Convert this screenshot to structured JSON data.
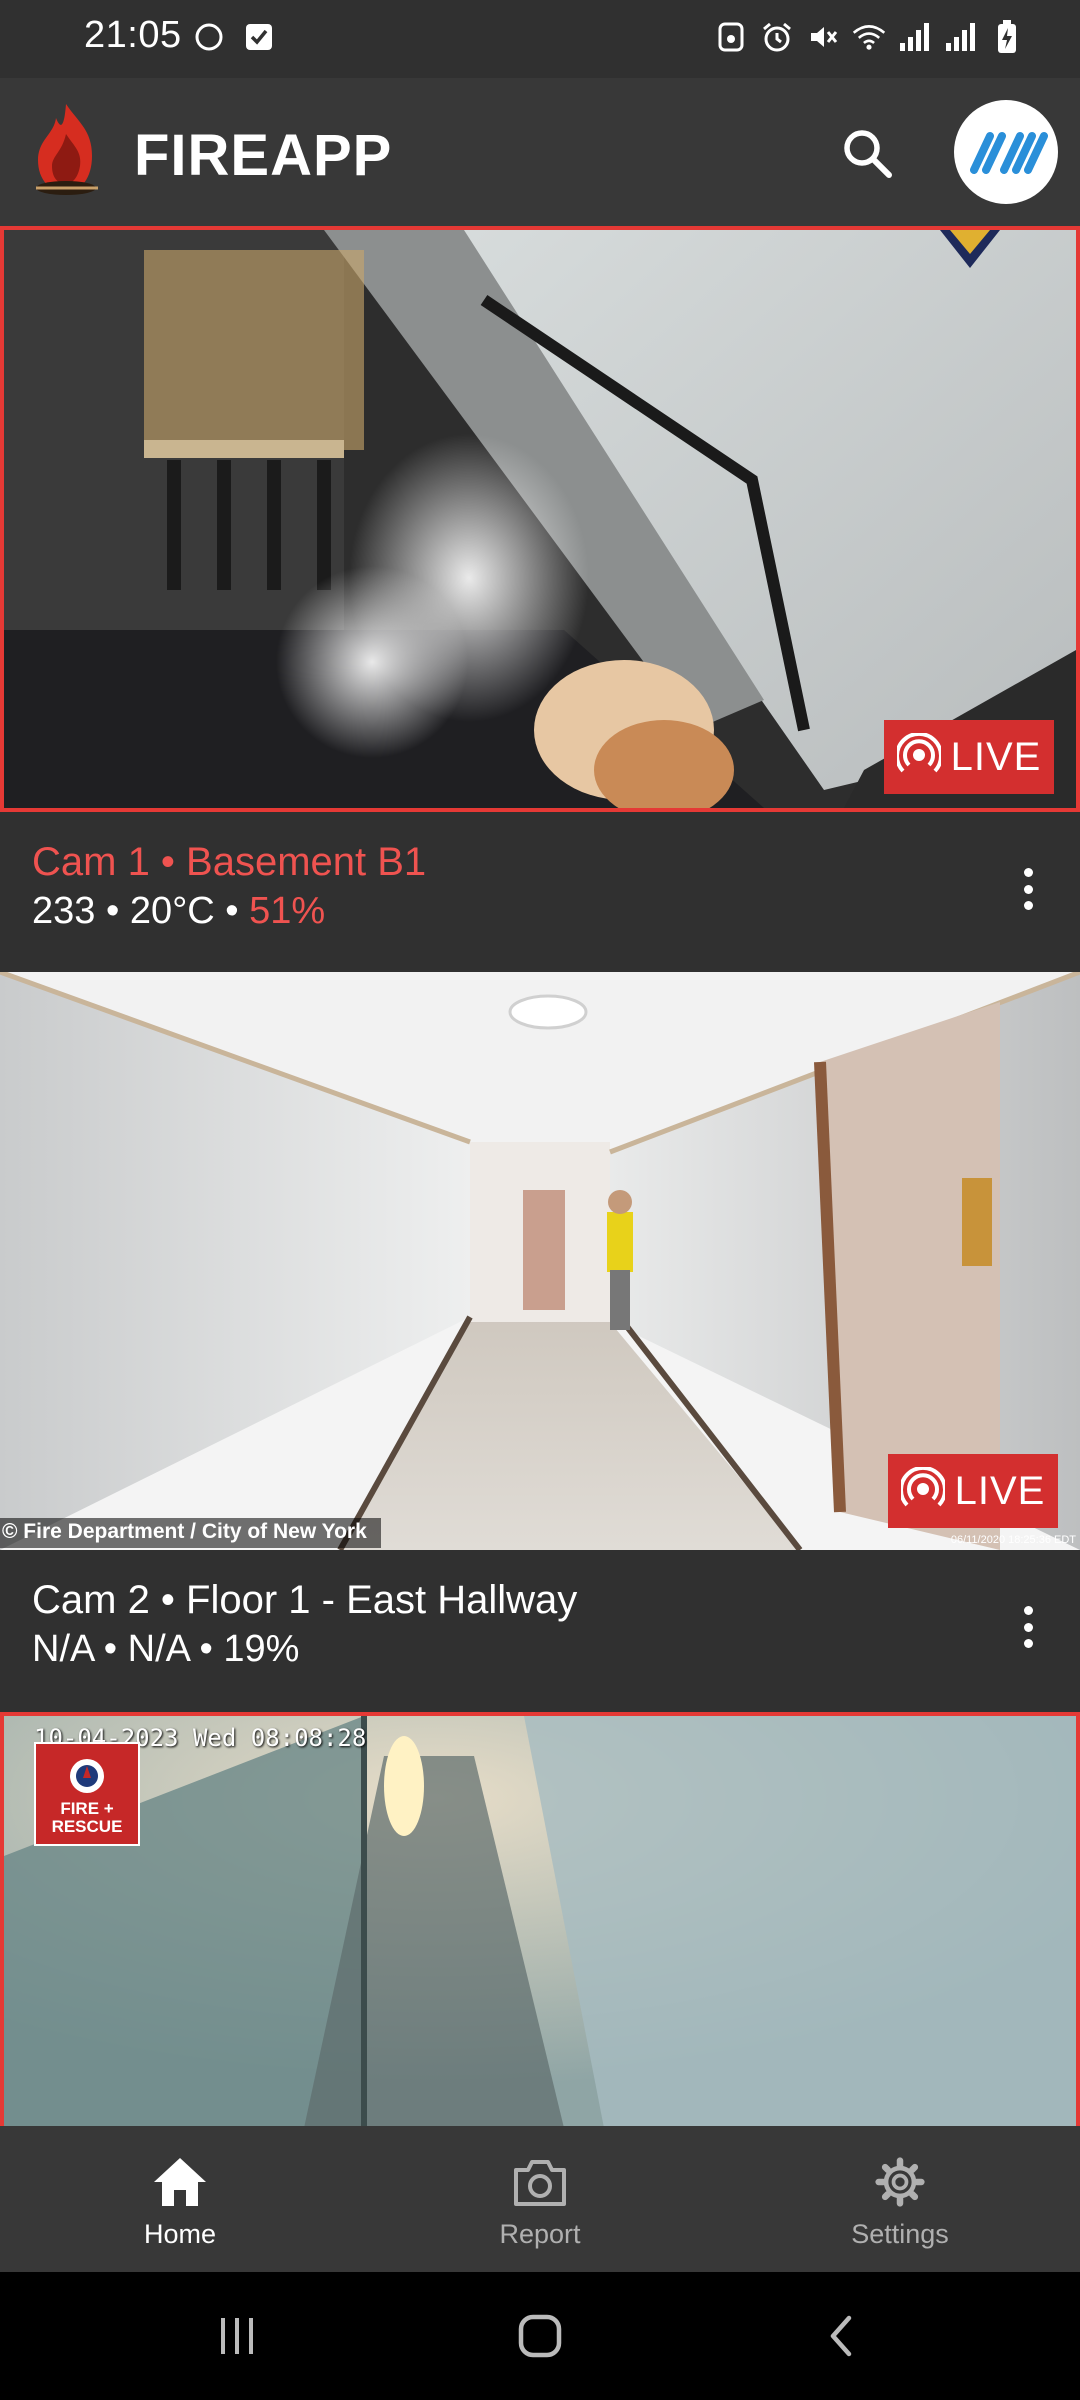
{
  "status_bar": {
    "time": "21:05",
    "icons": [
      "moon-icon",
      "checkbox-icon",
      "lock-icon",
      "alarm-icon",
      "mute-icon",
      "wifi-icon",
      "signal-icon",
      "signal-icon",
      "battery-charging-icon"
    ]
  },
  "app_bar": {
    "title": "FIREAPP",
    "icons": [
      "flame-logo-icon",
      "search-icon",
      "user-avatar"
    ]
  },
  "cameras": [
    {
      "name": "Cam 1 • Basement B1",
      "meta_prefix": "233 • 20°C • ",
      "meta_alert": "51%",
      "live_label": "LIVE",
      "alert": true
    },
    {
      "name": "Cam 2 • Floor 1 - East Hallway",
      "meta_prefix": "N/A • N/A • 19%",
      "meta_alert": "",
      "live_label": "LIVE",
      "alert": false,
      "caption": "© Fire Department / City of New York",
      "stamp": "06/11/2020 18:25:36 EDT"
    },
    {
      "alert": true,
      "timestamp": "10-04-2023 Wed 08:08:28",
      "badge": "FIRE + RESCUE"
    }
  ],
  "bottom_nav": {
    "items": [
      {
        "label": "Home",
        "icon": "home-icon",
        "active": true
      },
      {
        "label": "Report",
        "icon": "camera-icon",
        "active": false
      },
      {
        "label": "Settings",
        "icon": "gear-icon",
        "active": false
      }
    ]
  },
  "colors": {
    "accent_red": "#e53935",
    "live_red": "#d32f2f",
    "background": "#303030",
    "app_bar": "#383838"
  }
}
